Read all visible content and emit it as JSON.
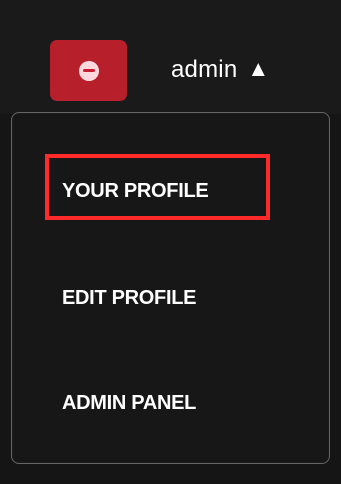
{
  "header": {
    "username": "admin",
    "dropdown_indicator": "▲",
    "status_icon_name": "minus-circle-icon"
  },
  "menu": {
    "items": [
      {
        "label": "YOUR PROFILE"
      },
      {
        "label": "EDIT PROFILE"
      },
      {
        "label": "ADMIN PANEL"
      }
    ]
  },
  "colors": {
    "background": "#151515",
    "topbar": "#1a1a1a",
    "status_button": "#b71f2a",
    "status_icon": "#ffd8dd",
    "menu_border": "#646464",
    "highlight": "#ff2a2a",
    "text": "#ffffff"
  }
}
